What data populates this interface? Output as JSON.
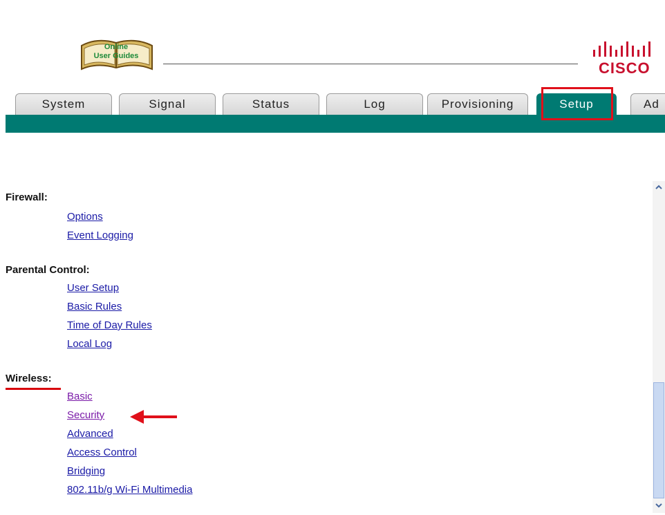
{
  "header": {
    "logo_text_line1": "Online",
    "logo_text_line2": "User Guides",
    "brand": "CISCO"
  },
  "tabs": [
    {
      "label": "System",
      "active": false
    },
    {
      "label": "Signal",
      "active": false
    },
    {
      "label": "Status",
      "active": false
    },
    {
      "label": "Log",
      "active": false
    },
    {
      "label": "Provisioning",
      "active": false
    },
    {
      "label": "Setup",
      "active": true
    },
    {
      "label": "Ad",
      "active": false
    }
  ],
  "sections": {
    "firewall": {
      "title": "Firewall:",
      "links": [
        "Options",
        "Event Logging"
      ]
    },
    "parental": {
      "title": "Parental Control:",
      "links": [
        "User Setup",
        "Basic Rules",
        "Time of Day Rules",
        "Local Log"
      ]
    },
    "wireless": {
      "title": "Wireless:",
      "links": [
        "Basic",
        "Security",
        "Advanced",
        "Access Control",
        "Bridging",
        "802.11b/g Wi-Fi Multimedia"
      ]
    }
  },
  "colors": {
    "tab_bar": "#007a72",
    "highlight": "#e0101a",
    "link": "#1a1aa6",
    "visited_link": "#7a1aa8",
    "cisco_red": "#c8102e"
  },
  "icons": {
    "logo": "open-book-icon",
    "brand": "cisco-bars-icon",
    "annotation": "red-arrow-icon",
    "scroll_up": "chevron-up-icon",
    "scroll_down": "chevron-down-icon"
  }
}
